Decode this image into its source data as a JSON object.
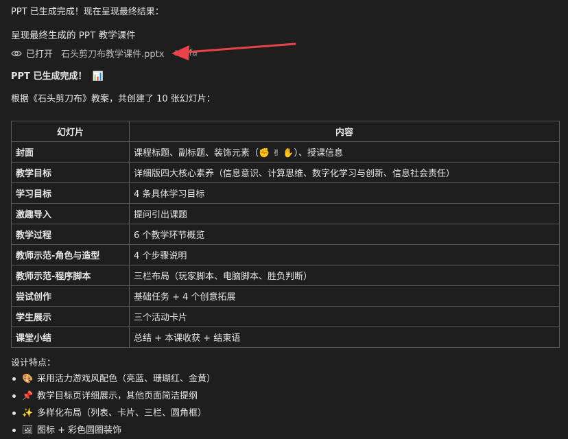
{
  "intro": "PPT 已生成完成！现在呈现最终结果：",
  "subtitle": "呈现最终生成的 PPT 教学课件",
  "opened": {
    "label": "已打开",
    "file": "石头剪刀布教学课件.pptx",
    "tag": "artifa"
  },
  "done": {
    "text": "PPT 已生成完成！",
    "emoji": "📊"
  },
  "summary": "根据《石头剪刀布》教案，共创建了 10 张幻灯片：",
  "table": {
    "headers": [
      "幻灯片",
      "内容"
    ],
    "rows": [
      [
        "封面",
        "课程标题、副标题、装饰元素（✊ ✌ ✋）、授课信息"
      ],
      [
        "教学目标",
        "详细版四大核心素养（信息意识、计算思维、数字化学习与创新、信息社会责任）"
      ],
      [
        "学习目标",
        "4 条具体学习目标"
      ],
      [
        "激趣导入",
        "提问引出课题"
      ],
      [
        "教学过程",
        "6 个教学环节概览"
      ],
      [
        "教师示范-角色与造型",
        "4 个步骤说明"
      ],
      [
        "教师示范-程序脚本",
        "三栏布局（玩家脚本、电脑脚本、胜负判断）"
      ],
      [
        "尝试创作",
        "基础任务 + 4 个创意拓展"
      ],
      [
        "学生展示",
        "三个活动卡片"
      ],
      [
        "课堂小结",
        "总结 + 本课收获 + 结束语"
      ]
    ]
  },
  "design_title": "设计特点：",
  "features": [
    {
      "emoji": "🎨",
      "text": "采用活力游戏风配色（亮蓝、珊瑚红、金黄）"
    },
    {
      "emoji": "📌",
      "text": "教学目标页详细展示，其他页面简洁提纲"
    },
    {
      "emoji": "✨",
      "text": "多样化布局（列表、卡片、三栏、圆角框）"
    },
    {
      "emoji": "🖼",
      "text": "图标 + 彩色圆圈装饰"
    }
  ],
  "colors": {
    "background": "#1e1e1e",
    "text": "#e6e6e6",
    "border": "#5a5a5a",
    "arrow": "#e8434a"
  }
}
